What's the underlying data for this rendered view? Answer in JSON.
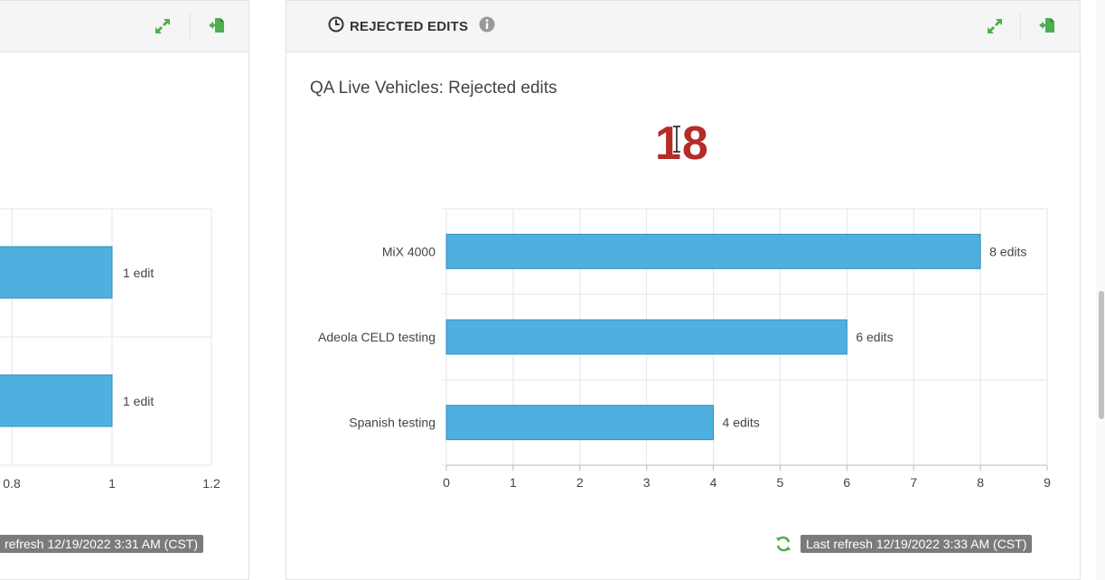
{
  "left_panel": {
    "chart_data": {
      "type": "bar",
      "orientation": "horizontal",
      "categories": [
        "",
        ""
      ],
      "values": [
        1,
        1
      ],
      "data_labels": [
        "1 edit",
        "1 edit"
      ],
      "x_ticks": [
        "0.8",
        "1",
        "1.2"
      ],
      "xlim": [
        0,
        1.2
      ],
      "grid": true,
      "bar_color": "#4fb0e0"
    },
    "refresh_text": "refresh 12/19/2022 3:31 AM (CST)"
  },
  "right_panel": {
    "header_title": "REJECTED EDITS",
    "subtitle": "QA Live Vehicles: Rejected edits",
    "big_number": "18",
    "chart_data": {
      "type": "bar",
      "orientation": "horizontal",
      "categories": [
        "MiX 4000",
        "Adeola CELD testing",
        "Spanish testing"
      ],
      "values": [
        8,
        6,
        4
      ],
      "data_labels": [
        "8 edits",
        "6 edits",
        "4 edits"
      ],
      "x_ticks": [
        "0",
        "1",
        "2",
        "3",
        "4",
        "5",
        "6",
        "7",
        "8",
        "9"
      ],
      "xlim": [
        0,
        9
      ],
      "grid": true,
      "bar_color": "#4fb0e0"
    },
    "refresh_text": "Last refresh 12/19/2022 3:33 AM (CST)"
  },
  "colors": {
    "accent_green": "#4caf50",
    "bar_fill": "#4fb0e0",
    "bar_stroke": "#2f8fbf",
    "big_number": "#b52b27",
    "pill_bg": "#7b7b7b"
  },
  "icons": {
    "expand": "expand-icon",
    "export": "export-icon",
    "clock": "clock-icon",
    "info": "info-icon",
    "refresh": "refresh-icon"
  }
}
